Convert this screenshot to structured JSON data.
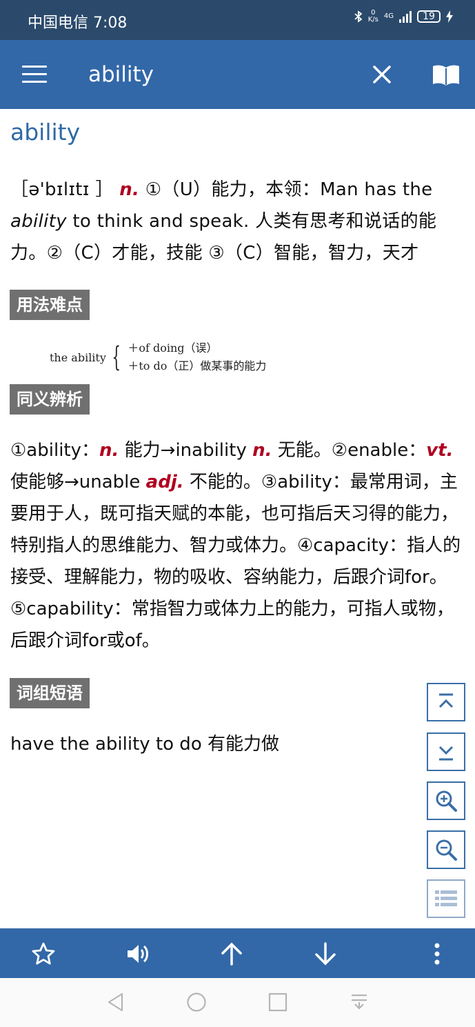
{
  "status_bar": {
    "carrier_time": "中国电信 7:08",
    "speed_value": "0",
    "speed_unit": "K/s",
    "network": "4G",
    "battery": "19"
  },
  "app_bar": {
    "search_value": "ability",
    "menu_icon": "menu-icon",
    "clear_icon": "close-icon",
    "book_icon": "book-icon"
  },
  "entry": {
    "headword": "ability",
    "definition": {
      "phonetic_open": "［",
      "phonetic": "ə'bɪlɪtɪ",
      "phonetic_close": " ］",
      "pos": "n.",
      "text_1": " ①（U）能力，本领：Man has the ",
      "example_italic": "ability",
      "text_2": " to think and speak. 人类有思考和说话的能力。②（C）才能，技能 ③（C）智能，智力，天才"
    },
    "usage": {
      "heading": "用法难点",
      "lead": "the ability",
      "option_1": "＋of doing（误）",
      "option_2": "＋to do（正）做某事的能力"
    },
    "synonyms": {
      "heading": "同义辨析",
      "s1": "①ability：",
      "pos1": "n.",
      "s2": " 能力→inability ",
      "pos2": "n.",
      "s3": " 无能。②enable：",
      "pos3": "vt.",
      "s4": " 使能够→unable ",
      "pos4": "adj.",
      "s5": " 不能的。③ability：最常用词，主要用于人，既可指天赋的本能，也可指后天习得的能力，特别指人的思维能力、智力或体力。④capacity：指人的接受、理解能力，物的吸收、容纳能力，后跟介词for。⑤capability：常指智力或体力上的能力，可指人或物，后跟介词for或of。"
    },
    "phrases": {
      "heading": "词组短语",
      "item_1": "have the ability to do 有能力做"
    }
  },
  "side_buttons": [
    "scroll-top-icon",
    "scroll-bottom-icon",
    "zoom-in-icon",
    "zoom-out-icon",
    "list-icon"
  ],
  "bottom_toolbar": [
    "star-icon",
    "speaker-icon",
    "arrow-up-icon",
    "arrow-down-icon",
    "more-vertical-icon"
  ],
  "nav_bar": [
    "back-icon",
    "home-icon",
    "recents-icon",
    "notification-pull-icon"
  ],
  "colors": {
    "status_bar": "#2b4a6b",
    "app_bar": "#3268a8",
    "headword": "#2e6aa6",
    "pos": "#b00020",
    "section_tag": "#707070"
  }
}
